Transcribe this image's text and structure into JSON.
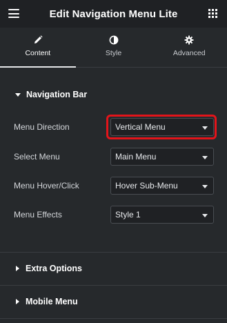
{
  "header": {
    "title": "Edit Navigation Menu Lite",
    "menu_icon": "hamburger-icon",
    "apps_icon": "grid-icon"
  },
  "tabs": [
    {
      "label": "Content",
      "icon": "pencil-icon",
      "active": true
    },
    {
      "label": "Style",
      "icon": "half-circle-icon",
      "active": false
    },
    {
      "label": "Advanced",
      "icon": "gear-icon",
      "active": false
    }
  ],
  "sections": {
    "navigation_bar": {
      "title": "Navigation Bar",
      "expanded": true,
      "fields": [
        {
          "label": "Menu Direction",
          "value": "Vertical Menu"
        },
        {
          "label": "Select Menu",
          "value": "Main Menu"
        },
        {
          "label": "Menu Hover/Click",
          "value": "Hover Sub-Menu"
        },
        {
          "label": "Menu Effects",
          "value": "Style 1"
        }
      ]
    },
    "extra_options": {
      "title": "Extra Options",
      "expanded": false
    },
    "mobile_menu": {
      "title": "Mobile Menu",
      "expanded": false
    }
  },
  "colors": {
    "panel_bg": "#26292c",
    "header_bg": "#1f2124",
    "highlight": "#e3141a"
  }
}
